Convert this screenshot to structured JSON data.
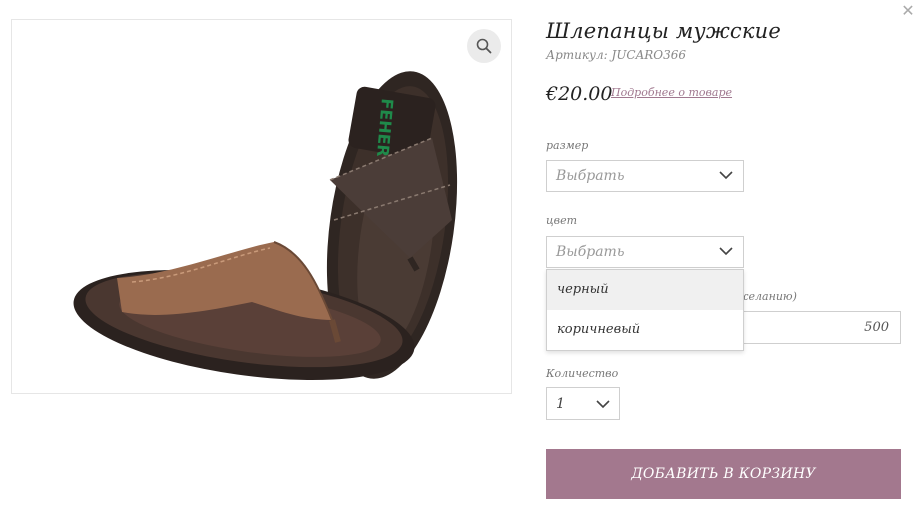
{
  "dialog": {
    "close_icon": "close-icon"
  },
  "gallery": {
    "zoom_icon": "magnifier-icon",
    "image_alt": "brown leather flip-flop sandals"
  },
  "product": {
    "title": "Шлепанцы мужские",
    "sku": "Артикул: JUCARO366",
    "price": "€20.00",
    "details_link": "Подробнее о товаре"
  },
  "size": {
    "label": "размер",
    "placeholder": "Выбрать"
  },
  "color": {
    "label": "цвет",
    "placeholder": "Выбрать",
    "options": [
      "черный",
      "коричневый"
    ]
  },
  "custom_field": {
    "label_tail": "желанию)",
    "value": "500"
  },
  "quantity": {
    "label": "Количество",
    "value": "1"
  },
  "cart": {
    "button_label": "ДОБАВИТЬ В КОРЗИНУ"
  },
  "colors": {
    "accent": "#a3788e",
    "link": "#a0788f",
    "border": "#cfcfcf"
  }
}
